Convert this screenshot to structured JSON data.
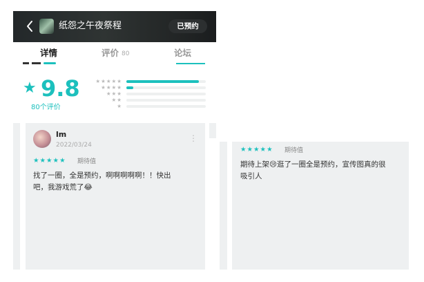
{
  "header": {
    "title": "纸怨之午夜祭程",
    "reserved_label": "已预约"
  },
  "tabs": [
    {
      "label": "详情"
    },
    {
      "label": "评价",
      "count": "80"
    },
    {
      "label": "论坛"
    }
  ],
  "rating": {
    "score": "9.8",
    "count_label": "80个评价",
    "distribution": [
      {
        "stars": "★★★★★",
        "fraction": 0.91
      },
      {
        "stars": "★★★★",
        "fraction": 0.09
      },
      {
        "stars": "★★★",
        "fraction": 0
      },
      {
        "stars": "★★",
        "fraction": 0
      },
      {
        "stars": "★",
        "fraction": 0
      }
    ]
  },
  "reviews": [
    {
      "user": "lm",
      "date": "2022/03/24",
      "stars": "★★★★★",
      "tag": "期待值",
      "text_line1": "找了一圈，全是预约，啊啊啊啊啊！！快出",
      "text_line2": "吧，我游戏荒了😂"
    },
    {
      "stars": "★★★★★",
      "tag": "期待值",
      "text_line1": "期待上架😢逛了一圈全是预约，宣传图真的很",
      "text_line2": "吸引人"
    }
  ],
  "colors": {
    "accent": "#1cc0bd",
    "header_bg": "#23282a",
    "card_bg": "#eef0f1"
  },
  "icons": {
    "back": "chevron-left-icon",
    "star": "star-icon",
    "more": "more-vertical-icon"
  }
}
